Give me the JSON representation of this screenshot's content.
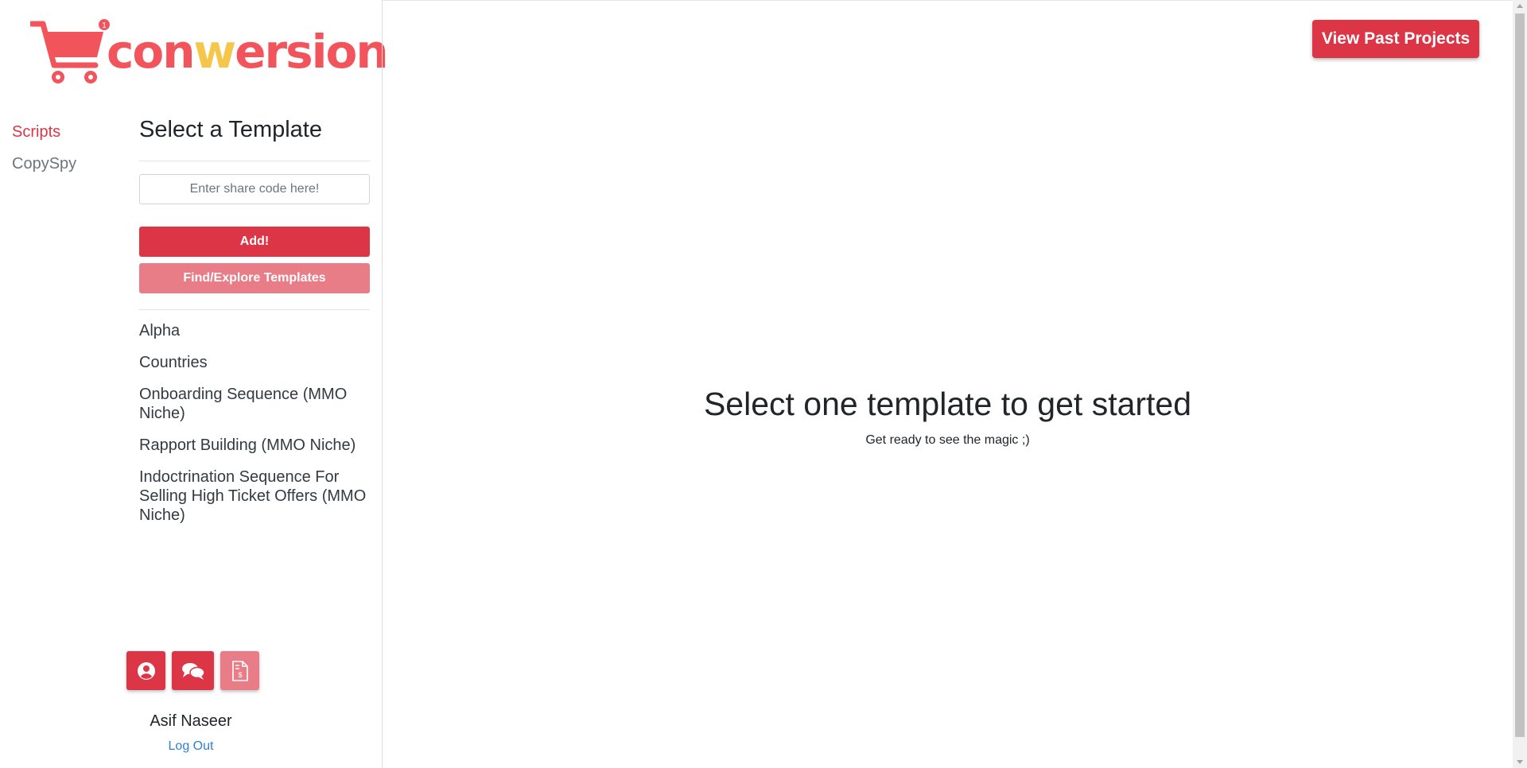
{
  "brand": {
    "name_start": "con",
    "name_mid": "w",
    "name_end": "ersion",
    "badge": "1",
    "primary_color": "#dc3545",
    "logo_color": "#f2545b",
    "accent_color": "#f5c64a"
  },
  "nav": {
    "items": [
      {
        "label": "Scripts",
        "active": true
      },
      {
        "label": "CopySpy",
        "active": false
      }
    ]
  },
  "panel": {
    "title": "Select a Template",
    "share_placeholder": "Enter share code here!",
    "add_label": "Add!",
    "explore_label": "Find/Explore Templates",
    "templates": [
      "Alpha",
      "Countries",
      "Onboarding Sequence (MMO Niche)",
      "Rapport Building (MMO Niche)",
      "Indoctrination Sequence For Selling High Ticket Offers (MMO Niche)"
    ]
  },
  "footer": {
    "icons": [
      "user-circle-icon",
      "chat-bubbles-icon",
      "invoice-icon"
    ],
    "user_name": "Asif Naseer",
    "logout_label": "Log Out"
  },
  "main": {
    "past_projects_label": "View Past Projects",
    "empty_title": "Select one template to get started",
    "empty_subtitle": "Get ready to see the magic ;)"
  }
}
